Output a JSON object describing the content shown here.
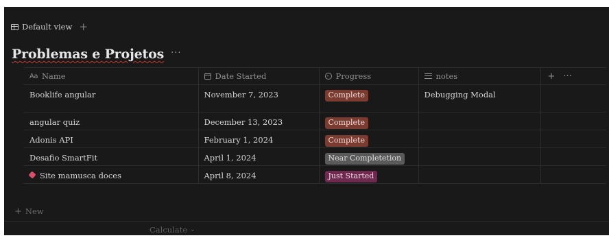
{
  "view_bar": {
    "view_name": "Default view",
    "add_label": "+"
  },
  "database": {
    "title": "Problemas e Projetos",
    "more_label": "···"
  },
  "columns": {
    "name": {
      "prefix": "Aa",
      "label": "Name"
    },
    "date": {
      "label": "Date Started"
    },
    "progress": {
      "label": "Progress"
    },
    "notes": {
      "label": "notes"
    },
    "add": "+",
    "more": "···"
  },
  "rows": [
    {
      "name": "Booklife angular",
      "date": "November 7, 2023",
      "progress": "Complete",
      "notes": "Debugging Modal",
      "icon": ""
    },
    {
      "name": "angular quiz",
      "date": "December 13, 2023",
      "progress": "Complete",
      "notes": "",
      "icon": ""
    },
    {
      "name": "Adonis API",
      "date": "February 1, 2024",
      "progress": "Complete",
      "notes": "",
      "icon": ""
    },
    {
      "name": "Desafio SmartFit",
      "date": "April 1, 2024",
      "progress": "Near Completetion",
      "notes": "",
      "icon": ""
    },
    {
      "name": "Site mamusca doces",
      "date": "April 8, 2024",
      "progress": "Just Started",
      "notes": "",
      "icon": "candy-icon"
    }
  ],
  "footer": {
    "new_plus": "+",
    "new_label": "New",
    "calculate_label": "Calculate",
    "calculate_chevron": "⌄"
  },
  "colors": {
    "background": "#191919",
    "complete": "#7a3b30",
    "near_completion": "#5a5a5a",
    "just_started": "#6e2a4e"
  }
}
